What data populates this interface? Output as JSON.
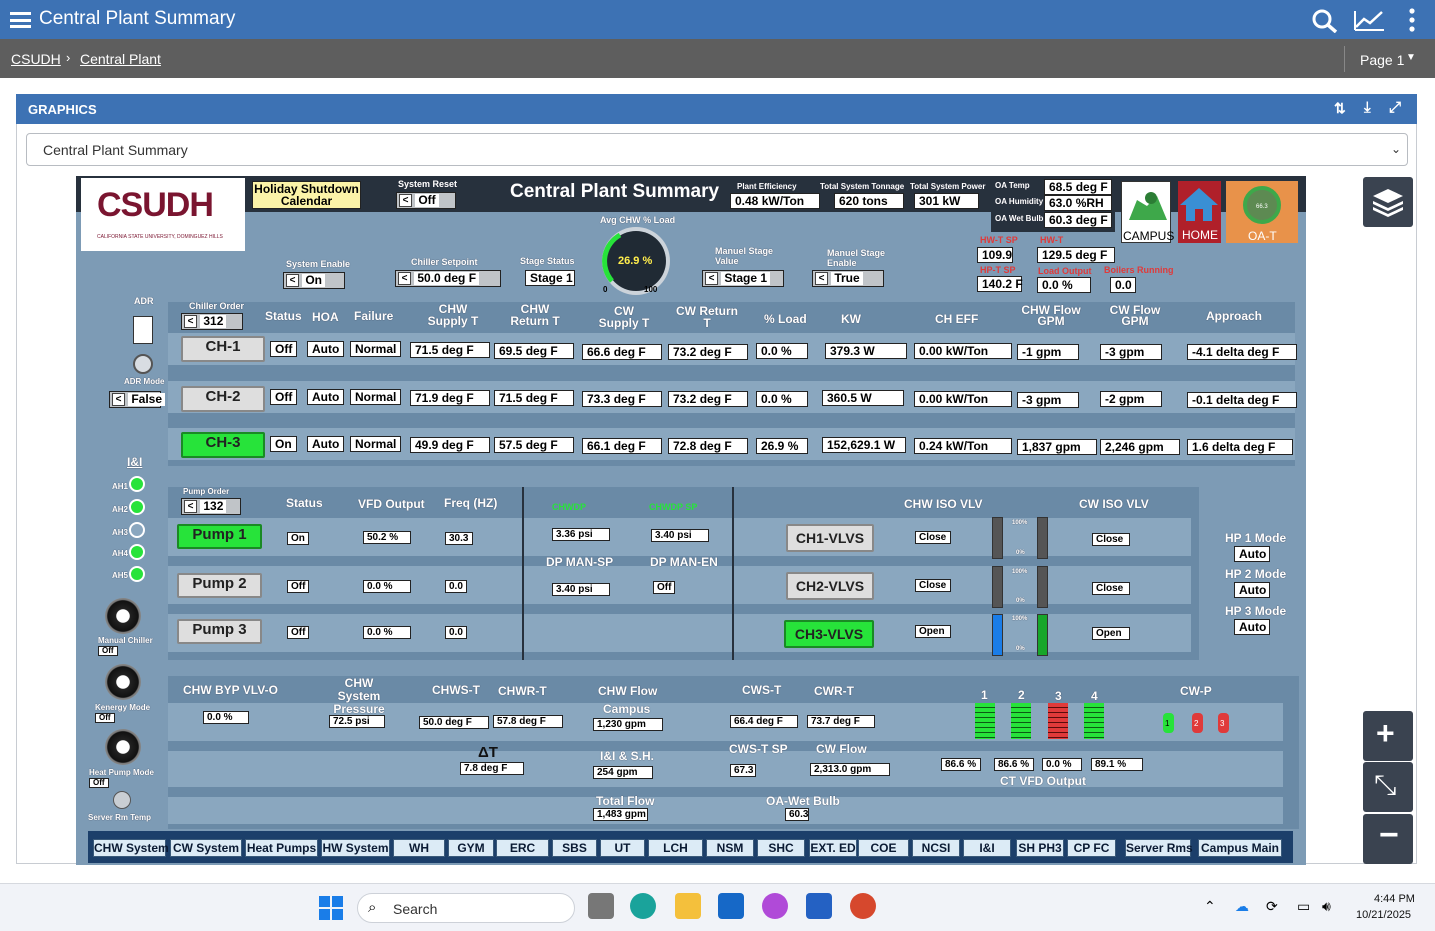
{
  "app": {
    "title": "Central Plant Summary",
    "menu_icon": "hamburger-icon"
  },
  "breadcrumb": {
    "root": "CSUDH",
    "current": "Central Plant",
    "page": "Page 1"
  },
  "panel": {
    "title": "GRAPHICS",
    "select_value": "Central Plant Summary"
  },
  "header": {
    "logo": "CSUDH",
    "logo_sub": "CALIFORNIA STATE UNIVERSITY, DOMINGUEZ HILLS",
    "holiday": "Holiday Shutdown Calendar",
    "system_reset_label": "System Reset",
    "system_reset": "Off",
    "title": "Central Plant Summary",
    "plant_eff_label": "Plant Efficiency",
    "plant_eff": "0.48 kW/Ton",
    "tonnage_label": "Total System Tonnage",
    "tonnage": "620 tons",
    "power_label": "Total System Power",
    "power": "301 kW",
    "oa_temp_label": "OA Temp",
    "oa_temp": "68.5 deg F",
    "oa_hum_label": "OA Humidity",
    "oa_hum": "63.0 %RH",
    "oa_wb_label": "OA Wet Bulb",
    "oa_wb": "60.3 deg F",
    "campus": "CAMPUS",
    "home": "HOME",
    "oat": "OA-T",
    "gauge_label": "Avg CHW % Load",
    "gauge_value": "26.9 %",
    "gauge_min": "0",
    "gauge_max": "100",
    "sys_enable_label": "System Enable",
    "sys_enable": "On",
    "chiller_sp_label": "Chiller Setpoint",
    "chiller_sp": "50.0  deg F",
    "stage_status_label": "Stage Status",
    "stage_status": "Stage 1",
    "man_stage_label": "Manuel Stage Value",
    "man_stage": "Stage 1",
    "man_enable_label": "Manuel Stage Enable",
    "man_enable": "True",
    "hwt_sp_label": "HW-T SP",
    "hwt_sp": "109.9",
    "hwt_label": "HW-T",
    "hwt": "129.5 deg F",
    "hpt_sp_label": "HP-T SP",
    "hpt_sp": "140.2 F",
    "load_out_label": "Load Output",
    "load_out": "0.0 %",
    "boilers_label": "Boilers Running",
    "boilers": "0.0"
  },
  "left": {
    "adr": "ADR",
    "adr_mode_label": "ADR Mode",
    "adr_mode": "False",
    "ii": "I&I",
    "ah": [
      "AH1",
      "AH2",
      "AH3",
      "AH4",
      "AH5"
    ],
    "manual_chiller": "Manual Chiller",
    "manual_chiller_v": "Off",
    "kenergy": "Kenergy Mode",
    "kenergy_v": "Off",
    "heat_pump": "Heat Pump Mode",
    "heat_pump_v": "Off",
    "server_temp": "Server Rm Temp"
  },
  "chillers": {
    "order_label": "Chiller Order",
    "order": "312",
    "columns": [
      "Status",
      "HOA",
      "Failure",
      "CHW Supply T",
      "CHW Return T",
      "CW Supply T",
      "CW Return T",
      "% Load",
      "KW",
      "CH EFF",
      "CHW Flow GPM",
      "CW Flow GPM",
      "Approach"
    ],
    "rows": [
      {
        "name": "CH-1",
        "status": "Off",
        "hoa": "Auto",
        "failure": "Normal",
        "chws": "71.5 deg F",
        "chwr": "69.5 deg F",
        "cws": "66.6 deg F",
        "cwr": "73.2 deg F",
        "load": "0.0 %",
        "kw": "379.3 W",
        "eff": "0.00 kW/Ton",
        "chwf": "-1 gpm",
        "cwf": "-3 gpm",
        "app": "-4.1 delta deg F"
      },
      {
        "name": "CH-2",
        "status": "Off",
        "hoa": "Auto",
        "failure": "Normal",
        "chws": "71.9 deg F",
        "chwr": "71.5 deg F",
        "cws": "73.3 deg F",
        "cwr": "73.2 deg F",
        "load": "0.0 %",
        "kw": "360.5 W",
        "eff": "0.00 kW/Ton",
        "chwf": "-3 gpm",
        "cwf": "-2 gpm",
        "app": "-0.1 delta deg F"
      },
      {
        "name": "CH-3",
        "status": "On",
        "hoa": "Auto",
        "failure": "Normal",
        "chws": "49.9 deg F",
        "chwr": "57.5 deg F",
        "cws": "66.1 deg F",
        "cwr": "72.8 deg F",
        "load": "26.9 %",
        "kw": "152,629.1 W",
        "eff": "0.24 kW/Ton",
        "chwf": "1,837 gpm",
        "cwf": "2,246 gpm",
        "app": "1.6 delta deg F"
      }
    ]
  },
  "pumps": {
    "order_label": "Pump Order",
    "order": "132",
    "columns": [
      "Status",
      "VFD Output",
      "Freq (HZ)"
    ],
    "rows": [
      {
        "name": "Pump 1",
        "status": "On",
        "vfd": "50.2 %",
        "freq": "30.3"
      },
      {
        "name": "Pump 2",
        "status": "Off",
        "vfd": "0.0 %",
        "freq": "0.0"
      },
      {
        "name": "Pump 3",
        "status": "Off",
        "vfd": "0.0 %",
        "freq": "0.0"
      }
    ],
    "chwdp_label": "CHWDP",
    "chwdp": "3.36 psi",
    "chwdp_sp_label": "CHWDP SP",
    "chwdp_sp": "3.40 psi",
    "dp_man_sp_label": "DP MAN-SP",
    "dp_man_sp": "3.40 psi",
    "dp_man_en_label": "DP MAN-EN",
    "dp_man_en": "Off",
    "chw_iso_label": "CHW ISO VLV",
    "cw_iso_label": "CW ISO VLV",
    "valves": [
      {
        "name": "CH1-VLVS",
        "chw": "Close",
        "cw": "Close"
      },
      {
        "name": "CH2-VLVS",
        "chw": "Close",
        "cw": "Close"
      },
      {
        "name": "CH3-VLVS",
        "chw": "Open",
        "cw": "Open"
      }
    ],
    "pct100": "100%",
    "pct0": "0%",
    "hp": [
      {
        "label": "HP 1 Mode",
        "value": "Auto"
      },
      {
        "label": "HP 2 Mode",
        "value": "Auto"
      },
      {
        "label": "HP 3 Mode",
        "value": "Auto"
      }
    ]
  },
  "bottom": {
    "byp_label": "CHW BYP VLV-O",
    "byp": "0.0 %",
    "press_label": "CHW System Pressure",
    "press": "72.5 psi",
    "chwst_label": "CHWS-T",
    "chwst": "50.0 deg F",
    "chwrt_label": "CHWR-T",
    "chwrt": "57.8 deg F",
    "dt_label": "ΔT",
    "dt": "7.8 deg F",
    "chwflow_label": "CHW Flow",
    "campus_label": "Campus",
    "campus": "1,230 gpm",
    "iish_label": "I&I & S.H.",
    "iish": "254 gpm",
    "cwst_label": "CWS-T",
    "cwst": "66.4 deg F",
    "cwrt_label": "CWR-T",
    "cwrt": "73.7 deg F",
    "cwst_sp_label": "CWS-T SP",
    "cwst_sp": "67.3",
    "cwflow_label": "CW Flow",
    "cwflow": "2,313.0 gpm",
    "total_label": "Total Flow",
    "total": "1,483 gpm",
    "oawb_label": "OA-Wet Bulb",
    "oawb": "60.3",
    "ct_nums": [
      "1",
      "2",
      "3",
      "4"
    ],
    "ct_vfd": [
      "86.6 %",
      "86.6 %",
      "0.0 %",
      "89.1 %"
    ],
    "ct_label": "CT VFD Output",
    "cwp_label": "CW-P",
    "cwp": [
      "1",
      "2",
      "3"
    ]
  },
  "nav": [
    "CHW System",
    "CW System",
    "Heat Pumps",
    "HW System",
    "WH",
    "GYM",
    "ERC",
    "SBS",
    "UT",
    "LCH",
    "NSM",
    "SHC",
    "EXT. ED",
    "COE",
    "NCSI",
    "I&I",
    "SH PH3",
    "CP FC",
    "Server Rms",
    "Campus Main"
  ],
  "taskbar": {
    "search": "Search",
    "time": "4:44 PM",
    "date": "10/21/2025"
  },
  "colors": {
    "brand": "#3d72b4",
    "on": "#27e33a",
    "alarm": "#e03a3a",
    "scada_bg": "#7d9bb5"
  }
}
